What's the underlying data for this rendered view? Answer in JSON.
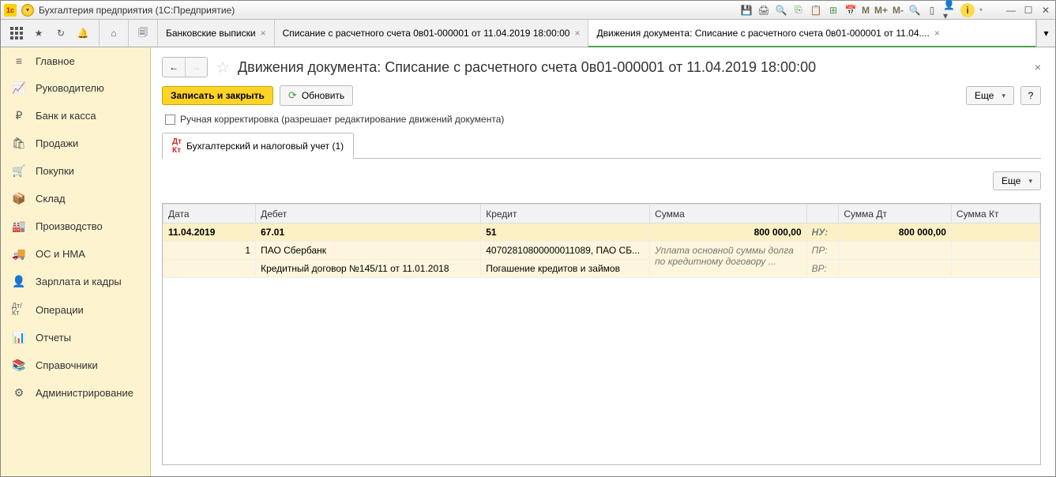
{
  "titlebar": {
    "app_title": "Бухгалтерия предприятия  (1С:Предприятие)"
  },
  "tabs": [
    {
      "label": "Банковские выписки"
    },
    {
      "label": "Списание с расчетного счета 0в01-000001 от 11.04.2019 18:00:00"
    },
    {
      "label": "Движения документа: Списание с расчетного счета 0в01-000001 от 11.04....",
      "active": true
    }
  ],
  "sidebar": {
    "items": [
      {
        "icon": "≡",
        "label": "Главное"
      },
      {
        "icon": "📈",
        "label": "Руководителю"
      },
      {
        "icon": "₽",
        "label": "Банк и касса"
      },
      {
        "icon": "🛍",
        "label": "Продажи"
      },
      {
        "icon": "🛒",
        "label": "Покупки"
      },
      {
        "icon": "📦",
        "label": "Склад"
      },
      {
        "icon": "🏭",
        "label": "Производство"
      },
      {
        "icon": "🚚",
        "label": "ОС и НМА"
      },
      {
        "icon": "👤",
        "label": "Зарплата и кадры"
      },
      {
        "icon": "Дт/Кт",
        "label": "Операции"
      },
      {
        "icon": "📊",
        "label": "Отчеты"
      },
      {
        "icon": "📚",
        "label": "Справочники"
      },
      {
        "icon": "⚙",
        "label": "Администрирование"
      }
    ]
  },
  "page": {
    "title": "Движения документа: Списание с расчетного счета 0в01-000001 от 11.04.2019 18:00:00",
    "buttons": {
      "save_close": "Записать и закрыть",
      "refresh": "Обновить",
      "more": "Еще",
      "help": "?"
    },
    "manual_edit_label": "Ручная корректировка (разрешает редактирование движений документа)",
    "subtab": "Бухгалтерский и налоговый учет (1)",
    "grid_more": "Еще"
  },
  "grid": {
    "headers": {
      "date": "Дата",
      "debit": "Дебет",
      "credit": "Кредит",
      "sum": "Сумма",
      "sum_dt": "Сумма Дт",
      "sum_kt": "Сумма Кт"
    },
    "row_main": {
      "date": "11.04.2019",
      "debit": "67.01",
      "credit": "51",
      "sum": "800 000,00",
      "nu_label": "НУ:",
      "sum_dt": "800 000,00"
    },
    "row_sub1": {
      "n": "1",
      "debit": "ПАО Сбербанк",
      "credit": "40702810800000011089, ПАО СБ...",
      "desc": "Уплата основной суммы долга по кредитному договору ...",
      "pr_label": "ПР:"
    },
    "row_sub2": {
      "debit": "Кредитный договор №145/11 от 11.01.2018",
      "credit": "Погашение кредитов и займов",
      "vr_label": "ВР:"
    }
  }
}
